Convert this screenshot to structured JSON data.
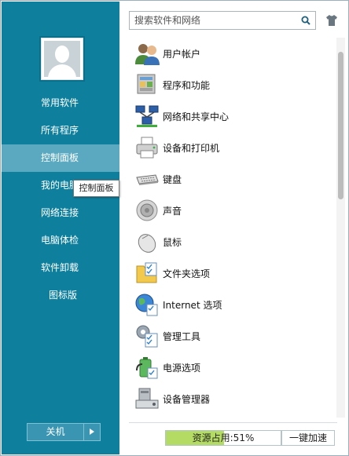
{
  "sidebar": {
    "items": [
      {
        "label": "常用软件"
      },
      {
        "label": "所有程序"
      },
      {
        "label": "控制面板"
      },
      {
        "label": "我的电脑"
      },
      {
        "label": "网络连接"
      },
      {
        "label": "电脑体检"
      },
      {
        "label": "软件卸载"
      },
      {
        "label": "图标版"
      }
    ],
    "active_index": 2,
    "tooltip": "控制面板",
    "shutdown_label": "关机"
  },
  "search": {
    "placeholder": "搜索软件和网络"
  },
  "panel_items": [
    {
      "label": "用户帐户",
      "icon": "users-icon"
    },
    {
      "label": "程序和功能",
      "icon": "programs-icon"
    },
    {
      "label": "网络和共享中心",
      "icon": "network-icon"
    },
    {
      "label": "设备和打印机",
      "icon": "printer-icon"
    },
    {
      "label": "键盘",
      "icon": "keyboard-icon"
    },
    {
      "label": "声音",
      "icon": "speaker-icon"
    },
    {
      "label": "鼠标",
      "icon": "mouse-icon"
    },
    {
      "label": "文件夹选项",
      "icon": "folder-options-icon"
    },
    {
      "label": "Internet 选项",
      "icon": "internet-options-icon"
    },
    {
      "label": "管理工具",
      "icon": "admin-tools-icon"
    },
    {
      "label": "电源选项",
      "icon": "power-options-icon"
    },
    {
      "label": "设备管理器",
      "icon": "device-manager-icon"
    }
  ],
  "footer": {
    "resource_label": "资源占用:51%",
    "resource_percent": 51,
    "boost_label": "一键加速"
  },
  "colors": {
    "sidebar_bg": "#0e7f9d",
    "sidebar_active": "#5aa9c0",
    "resource_fill": "#b4dc64"
  }
}
